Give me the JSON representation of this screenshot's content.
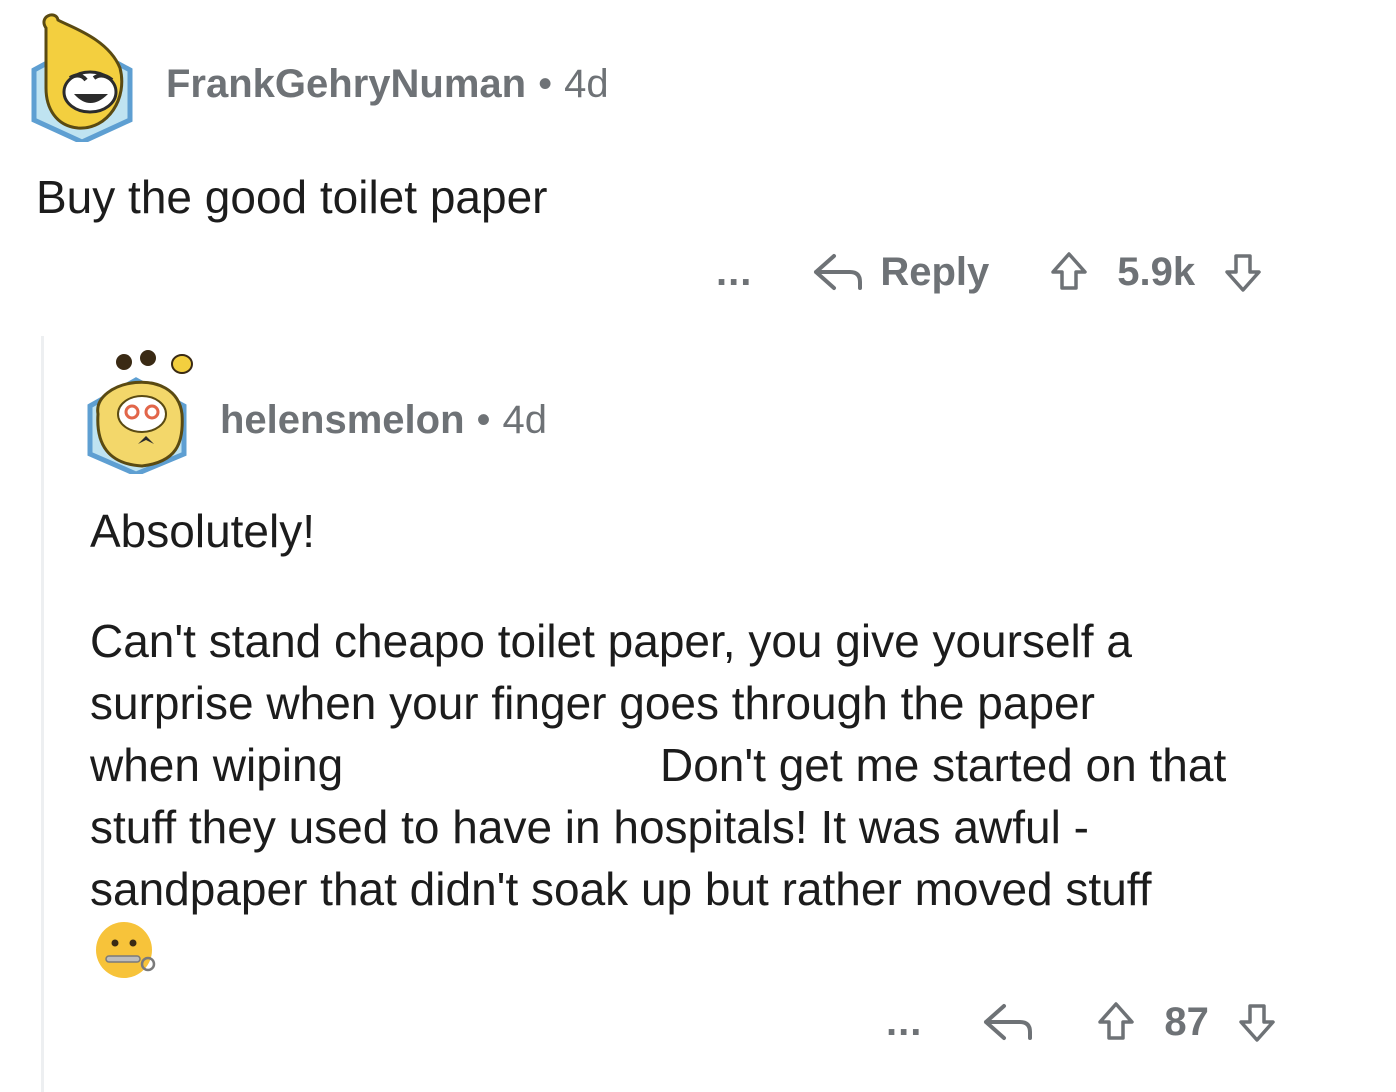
{
  "comments": [
    {
      "username": "FrankGehryNuman",
      "separator": "•",
      "age": "4d",
      "body": "Buy the good toilet paper",
      "actions": {
        "more": "...",
        "reply": "Reply",
        "score": "5.9k"
      }
    },
    {
      "username": "helensmelon",
      "separator": "•",
      "age": "4d",
      "body_lines": [
        "Absolutely!",
        "Can't stand cheapo toilet paper, you give yourself a",
        "surprise when your finger goes through the paper",
        "when wiping",
        "Don't get me started on that",
        "stuff they used to have in hospitals! It was awful -",
        "sandpaper that didn't soak up but rather moved stuff"
      ],
      "emoji": "🤐",
      "actions": {
        "more": "...",
        "score": "87"
      }
    }
  ],
  "icons": {
    "reply": "reply-arrow-icon",
    "upvote": "upvote-arrow-icon",
    "downvote": "downvote-arrow-icon"
  },
  "colors": {
    "meta_text": "#6e7276",
    "body_text": "#1c1c1c",
    "avatar_frame": "#5e9fd2",
    "thread_line": "#edeff1"
  }
}
